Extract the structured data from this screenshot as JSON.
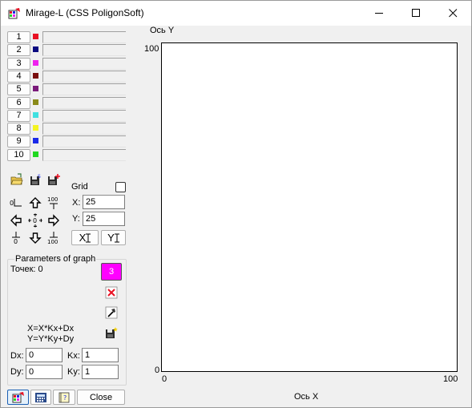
{
  "window": {
    "title": "Mirage-L (CSS PoligonSoft)",
    "minimize_glyph": "—",
    "maximize_glyph": "☐",
    "close_glyph": "✕"
  },
  "layers": [
    {
      "label": "1",
      "color": "#e81123"
    },
    {
      "label": "2",
      "color": "#0a0a80"
    },
    {
      "label": "3",
      "color": "#ee22ee"
    },
    {
      "label": "4",
      "color": "#7a0f0f"
    },
    {
      "label": "5",
      "color": "#7a1a7a"
    },
    {
      "label": "6",
      "color": "#8a8a1a"
    },
    {
      "label": "7",
      "color": "#40e0e0"
    },
    {
      "label": "8",
      "color": "#f4f422"
    },
    {
      "label": "9",
      "color": "#1a2ae8"
    },
    {
      "label": "10",
      "color": "#22d822"
    }
  ],
  "grid": {
    "label": "Grid",
    "checked": false,
    "x_label": "X:",
    "x_value": "25",
    "y_label": "Y:",
    "y_value": "25"
  },
  "nav": {
    "zero_label": "0",
    "origin_label": "0",
    "hundred_top": "100",
    "bottom_zero": "0",
    "bottom_hundred": "100",
    "x_fit_label": "X",
    "y_fit_label": "Y"
  },
  "params": {
    "title": "Parameters of graph",
    "points_label": "Точек: 0",
    "layer_number": "3",
    "layer_color": "#ff00ff",
    "formula_x": "X=X*Kx+Dx",
    "formula_y": "Y=Y*Ky+Dy",
    "dx_label": "Dx:",
    "dx_value": "0",
    "dy_label": "Dy:",
    "dy_value": "0",
    "kx_label": "Kx:",
    "kx_value": "1",
    "ky_label": "Ky:",
    "ky_value": "1"
  },
  "footer": {
    "close_label": "Close"
  },
  "chart_data": {
    "type": "scatter",
    "title": "",
    "xlabel": "Ось X",
    "ylabel": "Ось Y",
    "xlim": [
      0,
      100
    ],
    "ylim": [
      0,
      100
    ],
    "x_tick_labels": [
      "0",
      "100"
    ],
    "y_tick_labels": [
      "0",
      "100"
    ],
    "grid": false,
    "points": []
  }
}
